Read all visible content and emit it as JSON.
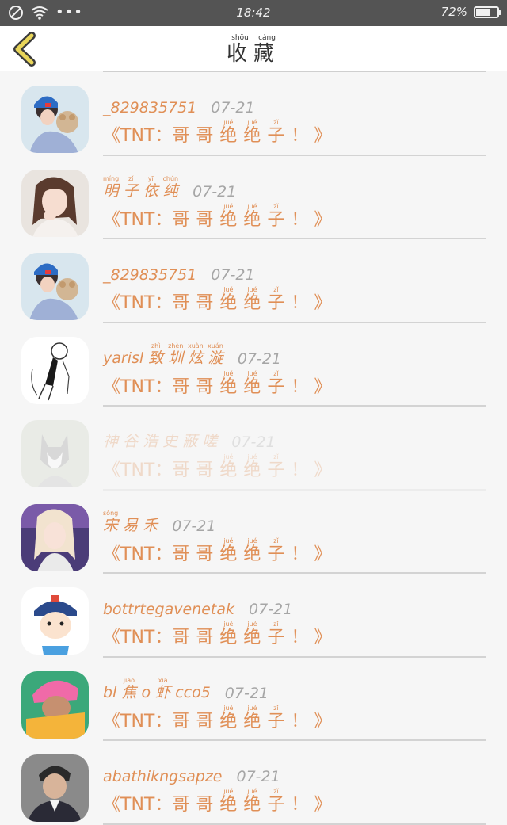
{
  "status_bar": {
    "time": "18:42",
    "battery_percent": 72,
    "battery_label": "72%",
    "more_dots": "•••"
  },
  "header": {
    "title_chars": [
      "收",
      "藏"
    ],
    "title_pinyin": [
      "shōu",
      "cáng"
    ]
  },
  "message_chars": {
    "prefix": "《TNT：",
    "c1": "哥",
    "c2": "哥",
    "c3": "绝",
    "c3_py": "jué",
    "c4": "绝",
    "c4_py": "jué",
    "c5": "子",
    "c5_py": "zǐ",
    "suffix": "！ 》"
  },
  "entries": [
    {
      "name": "_829835751",
      "date": "07-21",
      "faded": false
    },
    {
      "name_chars": [
        "明",
        "子",
        "依",
        "纯"
      ],
      "name_pinyin": [
        "míng",
        "zǐ",
        "yī",
        "chún"
      ],
      "date": "07-21",
      "faded": false
    },
    {
      "name": "_829835751",
      "date": "07-21",
      "faded": false
    },
    {
      "name_prefix": "yarisl",
      "name_chars": [
        "致",
        "圳",
        "炫",
        "漩"
      ],
      "name_pinyin": [
        "zhì",
        "zhèn",
        "xuàn",
        "xuán"
      ],
      "date": "07-21",
      "faded": false
    },
    {
      "name_chars": [
        "神",
        "谷",
        "浩",
        "史",
        "蔽",
        "嗟"
      ],
      "name_pinyin": [
        "",
        "",
        "",
        "",
        "",
        ""
      ],
      "date": "07-21",
      "faded": true
    },
    {
      "name_chars": [
        "宋",
        "易",
        "禾"
      ],
      "name_pinyin": [
        "sòng",
        "",
        ""
      ],
      "date": "07-21",
      "faded": false
    },
    {
      "name": "bottrtegavenetak",
      "date": "07-21",
      "faded": false
    },
    {
      "name_prefix": "bl",
      "name_chars": [
        "焦",
        "o",
        "虾"
      ],
      "name_pinyin": [
        "jiāo",
        "",
        "xiā"
      ],
      "name_suffix": "cco5",
      "date": "07-21",
      "faded": false
    },
    {
      "name": "abathikngsapze",
      "date": "07-21",
      "faded": false
    }
  ],
  "colors": {
    "accent": "#e08f56",
    "date": "#a6a6a6",
    "status_bar": "#545454",
    "background": "#f6f6f6"
  },
  "icons": {
    "back": "chevron-left-icon",
    "dnd": "do-not-disturb-icon",
    "wifi": "wifi-icon",
    "battery": "battery-icon"
  }
}
